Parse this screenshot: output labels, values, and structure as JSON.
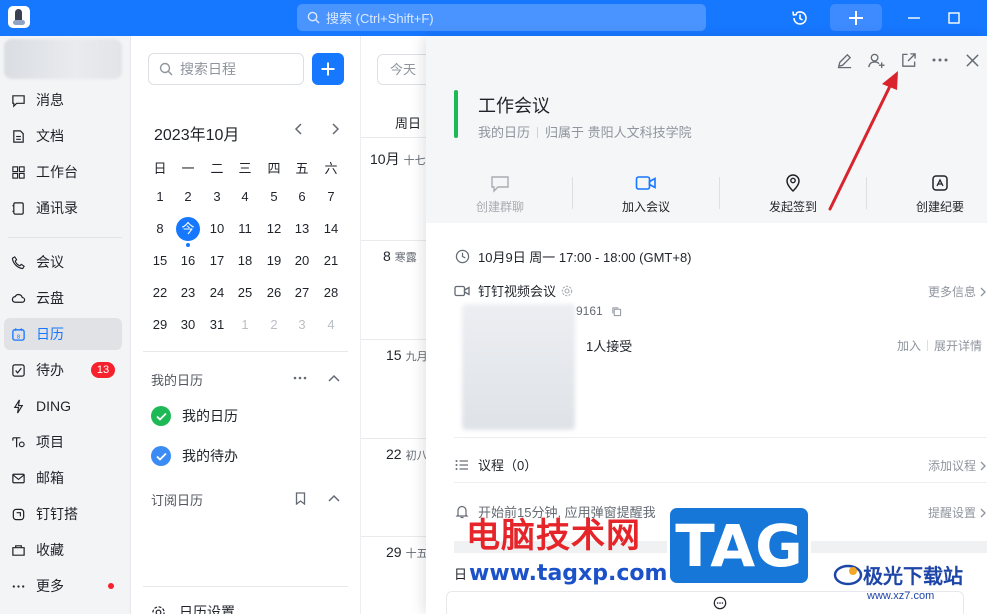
{
  "topbar": {
    "search_placeholder": "搜索 (Ctrl+Shift+F)"
  },
  "sidebar": {
    "items": [
      {
        "label": "消息",
        "icon": "message-icon"
      },
      {
        "label": "文档",
        "icon": "document-icon"
      },
      {
        "label": "工作台",
        "icon": "grid-icon"
      },
      {
        "label": "通讯录",
        "icon": "contacts-icon"
      },
      {
        "label": "会议",
        "icon": "phone-icon"
      },
      {
        "label": "云盘",
        "icon": "cloud-icon"
      },
      {
        "label": "日历",
        "icon": "calendar-icon",
        "active": true
      },
      {
        "label": "待办",
        "icon": "todo-icon",
        "badge": "13"
      },
      {
        "label": "DING",
        "icon": "bolt-icon"
      },
      {
        "label": "项目",
        "icon": "project-icon"
      },
      {
        "label": "邮箱",
        "icon": "mail-icon"
      },
      {
        "label": "钉钉搭",
        "icon": "builder-icon"
      },
      {
        "label": "收藏",
        "icon": "favorite-icon"
      },
      {
        "label": "更多",
        "icon": "more-icon",
        "dot": true
      }
    ]
  },
  "calendar": {
    "search_placeholder": "搜索日程",
    "month_title": "2023年10月",
    "weekdays": [
      "日",
      "一",
      "二",
      "三",
      "四",
      "五",
      "六"
    ],
    "weeks": [
      [
        "1",
        "2",
        "3",
        "4",
        "5",
        "6",
        "7"
      ],
      [
        "8",
        "今",
        "10",
        "11",
        "12",
        "13",
        "14"
      ],
      [
        "15",
        "16",
        "17",
        "18",
        "19",
        "20",
        "21"
      ],
      [
        "22",
        "23",
        "24",
        "25",
        "26",
        "27",
        "28"
      ],
      [
        "29",
        "30",
        "31",
        "1",
        "2",
        "3",
        "4"
      ]
    ],
    "my_calendars_title": "我的日历",
    "my_calendars": [
      "我的日历",
      "我的待办"
    ],
    "subscribed_title": "订阅日历",
    "settings_label": "日历设置"
  },
  "week_view": {
    "today_button": "今天",
    "header": "周日",
    "dates": [
      {
        "day": "10月",
        "lunar": "十七"
      },
      {
        "day": "8",
        "lunar": "寒露"
      },
      {
        "day": "15",
        "lunar": "九月"
      },
      {
        "day": "22",
        "lunar": "初八"
      },
      {
        "day": "29",
        "lunar": "十五"
      }
    ]
  },
  "event": {
    "title": "工作会议",
    "calendar": "我的日历",
    "owner": "归属于 贵阳人文科技学院",
    "color": "#1db954",
    "quick_actions": [
      {
        "label": "创建群聊",
        "icon": "chat-icon",
        "enabled": false
      },
      {
        "label": "加入会议",
        "icon": "video-icon",
        "enabled": true
      },
      {
        "label": "发起签到",
        "icon": "location-icon",
        "enabled": true
      },
      {
        "label": "创建纪要",
        "icon": "notes-icon",
        "enabled": true
      }
    ],
    "time": "10月9日 周一 17:00 - 18:00 (GMT+8)",
    "meeting_type": "钉钉视频会议",
    "meeting_id_fragment": "9161",
    "more_info": "更多信息",
    "attendees": "1人接受",
    "join": "加入",
    "expand": "展开详情",
    "agenda": "议程（0）",
    "add_agenda": "添加议程",
    "reminder": "开始前15分钟, 应用弹窗提醒我",
    "reminder_settings": "提醒设置",
    "footer_label": "日"
  },
  "watermark": {
    "cn": "电脑技术网",
    "url": "www.tagxp.com",
    "tag": "TAG",
    "brand": "极光下载站",
    "brand_url": "www.xz7.com"
  },
  "colors": {
    "primary": "#1677ff",
    "badge": "#f5222d",
    "arrow": "#d9232d"
  }
}
